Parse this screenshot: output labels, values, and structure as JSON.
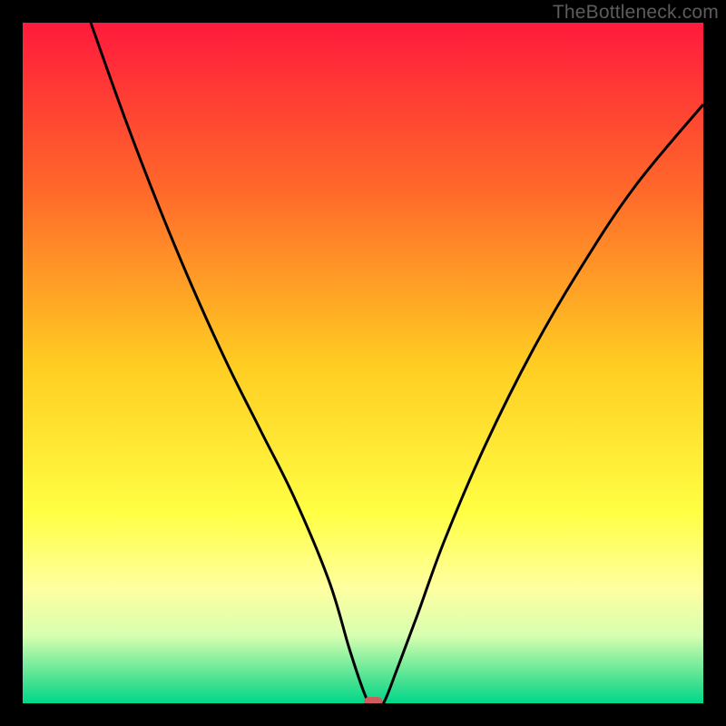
{
  "attribution": "TheBottleneck.com",
  "chart_data": {
    "type": "line",
    "title": "",
    "xlabel": "",
    "ylabel": "",
    "xlim": [
      0,
      100
    ],
    "ylim": [
      0,
      100
    ],
    "grid": false,
    "legend": false,
    "background": {
      "type": "vertical-score-gradient",
      "description": "Red (top / high bottleneck) through orange, yellow, down to green (bottom / low bottleneck)",
      "stops": [
        {
          "pct": 0,
          "color": "#ff1a3c"
        },
        {
          "pct": 25,
          "color": "#ff6a2a"
        },
        {
          "pct": 50,
          "color": "#ffcc22"
        },
        {
          "pct": 72,
          "color": "#ffff44"
        },
        {
          "pct": 83,
          "color": "#ffffa0"
        },
        {
          "pct": 90,
          "color": "#d8ffb0"
        },
        {
          "pct": 97,
          "color": "#40e090"
        },
        {
          "pct": 100,
          "color": "#00d88a"
        }
      ]
    },
    "series": [
      {
        "name": "bottleneck-curve",
        "color": "#000000",
        "x": [
          10,
          15,
          20,
          25,
          30,
          35,
          40,
          45,
          48,
          50,
          51,
          52,
          53,
          55,
          58,
          62,
          68,
          75,
          82,
          90,
          100
        ],
        "y": [
          100,
          86,
          73,
          61,
          50,
          40,
          30,
          18,
          8,
          2,
          0,
          0,
          0,
          5,
          13,
          24,
          38,
          52,
          64,
          76,
          88
        ]
      }
    ],
    "marker": {
      "name": "value-marker",
      "x": 51.5,
      "y": 0,
      "color": "#cd5c5c",
      "shape": "rounded-rect"
    }
  }
}
